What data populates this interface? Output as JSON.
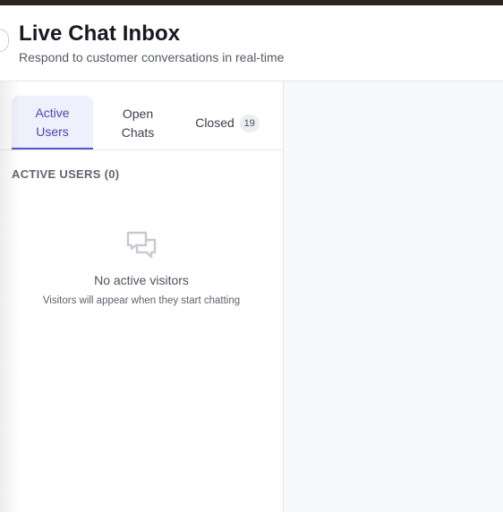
{
  "header": {
    "title": "Live Chat Inbox",
    "subtitle": "Respond to customer conversations in real-time"
  },
  "tabs": [
    {
      "label_line1": "Active",
      "label_line2": "Users",
      "active": true
    },
    {
      "label_line1": "Open",
      "label_line2": "Chats",
      "active": false
    },
    {
      "label": "Closed",
      "count": "19",
      "active": false
    }
  ],
  "active_users": {
    "section_label": "ACTIVE USERS (0)",
    "empty_icon": "chat-bubbles-icon",
    "empty_title": "No active visitors",
    "empty_description": "Visitors will appear when they start chatting"
  },
  "colors": {
    "accent": "#5b54c9",
    "active_tab_bg": "#eef0fb",
    "topbar": "#2b2522",
    "right_panel_bg": "#f8f9fb"
  }
}
